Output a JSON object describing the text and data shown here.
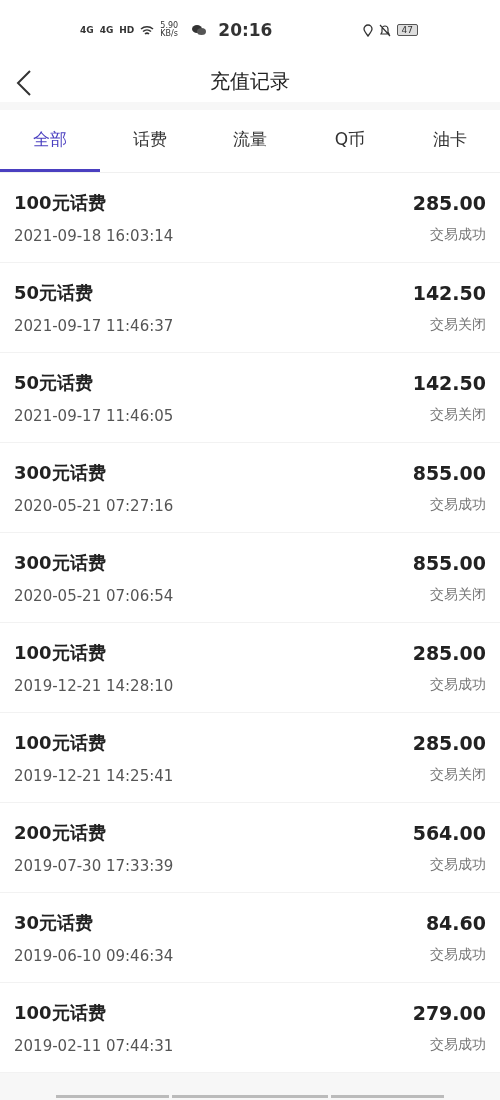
{
  "status_bar": {
    "network_1": "4G",
    "network_2": "4G",
    "hd": "HD",
    "speed": "5.90 KB/s",
    "time": "20:16",
    "battery": "47"
  },
  "header": {
    "title": "充值记录"
  },
  "tabs": [
    {
      "label": "全部",
      "selected": true
    },
    {
      "label": "话费",
      "selected": false
    },
    {
      "label": "流量",
      "selected": false
    },
    {
      "label": "Q币",
      "selected": false
    },
    {
      "label": "油卡",
      "selected": false
    }
  ],
  "records": [
    {
      "title": "100元话费",
      "time": "2021-09-18 16:03:14",
      "amount": "285.00",
      "status": "交易成功"
    },
    {
      "title": "50元话费",
      "time": "2021-09-17 11:46:37",
      "amount": "142.50",
      "status": "交易关闭"
    },
    {
      "title": "50元话费",
      "time": "2021-09-17 11:46:05",
      "amount": "142.50",
      "status": "交易关闭"
    },
    {
      "title": "300元话费",
      "time": "2020-05-21 07:27:16",
      "amount": "855.00",
      "status": "交易成功"
    },
    {
      "title": "300元话费",
      "time": "2020-05-21 07:06:54",
      "amount": "855.00",
      "status": "交易关闭"
    },
    {
      "title": "100元话费",
      "time": "2019-12-21 14:28:10",
      "amount": "285.00",
      "status": "交易成功"
    },
    {
      "title": "100元话费",
      "time": "2019-12-21 14:25:41",
      "amount": "285.00",
      "status": "交易关闭"
    },
    {
      "title": "200元话费",
      "time": "2019-07-30 17:33:39",
      "amount": "564.00",
      "status": "交易成功"
    },
    {
      "title": "30元话费",
      "time": "2019-06-10 09:46:34",
      "amount": "84.60",
      "status": "交易成功"
    },
    {
      "title": "100元话费",
      "time": "2019-02-11 07:44:31",
      "amount": "279.00",
      "status": "交易成功"
    }
  ]
}
